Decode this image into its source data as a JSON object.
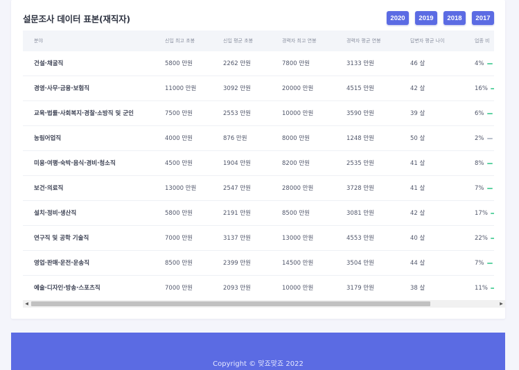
{
  "card": {
    "title": "설문조사 데이터 표본(재직자)",
    "years": [
      "2020",
      "2019",
      "2018",
      "2017"
    ]
  },
  "table": {
    "columns": [
      "분야",
      "신입 최고 초봉",
      "신입 평균 초봉",
      "경력자 최고 연봉",
      "경력자 평균 연봉",
      "답변자 평균 나이",
      "업종 비"
    ],
    "rows": [
      {
        "field": "건설·채굴직",
        "new_max": "5800 만원",
        "new_avg": "2262 만원",
        "exp_max": "7800 만원",
        "exp_avg": "3133 만원",
        "age": "46 살",
        "pct": "4%",
        "pct_value": 4
      },
      {
        "field": "경영·사무·금융·보험직",
        "new_max": "11000 만원",
        "new_avg": "3092 만원",
        "exp_max": "20000 만원",
        "exp_avg": "4515 만원",
        "age": "42 살",
        "pct": "16%",
        "pct_value": 16
      },
      {
        "field": "교육·법률·사회복지·경찰·소방직 및 군인",
        "new_max": "7500 만원",
        "new_avg": "2553 만원",
        "exp_max": "10000 만원",
        "exp_avg": "3590 만원",
        "age": "39 살",
        "pct": "6%",
        "pct_value": 6
      },
      {
        "field": "농림어업직",
        "new_max": "4000 만원",
        "new_avg": "876 만원",
        "exp_max": "8000 만원",
        "exp_avg": "1248 만원",
        "age": "50 살",
        "pct": "2%",
        "pct_value": 2
      },
      {
        "field": "미용·여행·숙박·음식·경비·청소직",
        "new_max": "4500 만원",
        "new_avg": "1904 만원",
        "exp_max": "8200 만원",
        "exp_avg": "2535 만원",
        "age": "41 살",
        "pct": "8%",
        "pct_value": 8
      },
      {
        "field": "보건·의료직",
        "new_max": "13000 만원",
        "new_avg": "2547 만원",
        "exp_max": "28000 만원",
        "exp_avg": "3728 만원",
        "age": "41 살",
        "pct": "7%",
        "pct_value": 7
      },
      {
        "field": "설치·정비·생산직",
        "new_max": "5800 만원",
        "new_avg": "2191 만원",
        "exp_max": "8500 만원",
        "exp_avg": "3081 만원",
        "age": "42 살",
        "pct": "17%",
        "pct_value": 17
      },
      {
        "field": "연구직 및 공학 기술직",
        "new_max": "7000 만원",
        "new_avg": "3137 만원",
        "exp_max": "13000 만원",
        "exp_avg": "4553 만원",
        "age": "40 살",
        "pct": "22%",
        "pct_value": 22
      },
      {
        "field": "영업·판매·운전·운송직",
        "new_max": "8500 만원",
        "new_avg": "2399 만원",
        "exp_max": "14500 만원",
        "exp_avg": "3504 만원",
        "age": "44 살",
        "pct": "7%",
        "pct_value": 7
      },
      {
        "field": "예술·디자인·방송·스포츠직",
        "new_max": "7000 만원",
        "new_avg": "2093 만원",
        "exp_max": "10000 만원",
        "exp_avg": "3179 만원",
        "age": "38 살",
        "pct": "11%",
        "pct_value": 11
      }
    ]
  },
  "colors": {
    "accent": "#5b6be3",
    "bar_green": "#5fd3a3"
  },
  "footer": {
    "copyright": "Copyright © 맞죠맞죠 2022"
  }
}
